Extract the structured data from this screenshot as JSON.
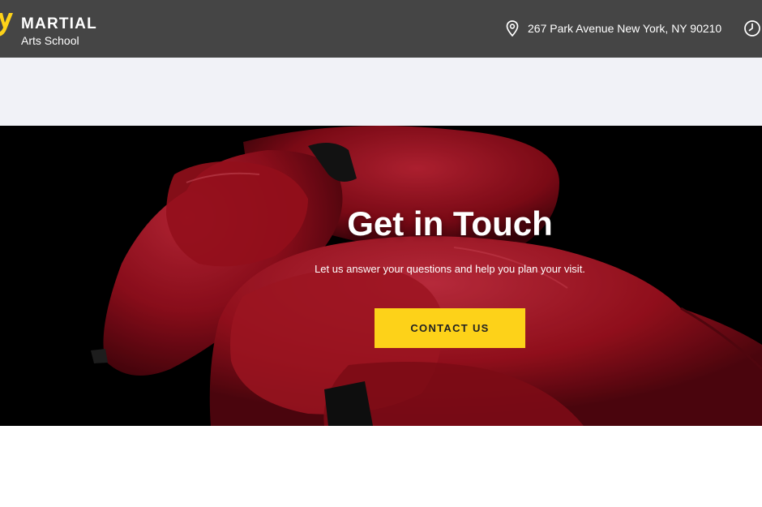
{
  "header": {
    "logo_title": "MARTIAL",
    "logo_subtitle": "Arts School",
    "address": "267 Park Avenue New York, NY 90210",
    "icons": {
      "logo": "logo-mark-icon",
      "location": "map-pin-icon",
      "hours": "clock-icon"
    }
  },
  "hero": {
    "title": "Get in Touch",
    "subtitle": "Let us answer your questions and help you plan your visit.",
    "cta_label": "CONTACT US"
  },
  "colors": {
    "header_bg": "#454545",
    "accent": "#fdd219",
    "band_bg": "#f1f2f7",
    "glove_red": "#b0121f"
  }
}
